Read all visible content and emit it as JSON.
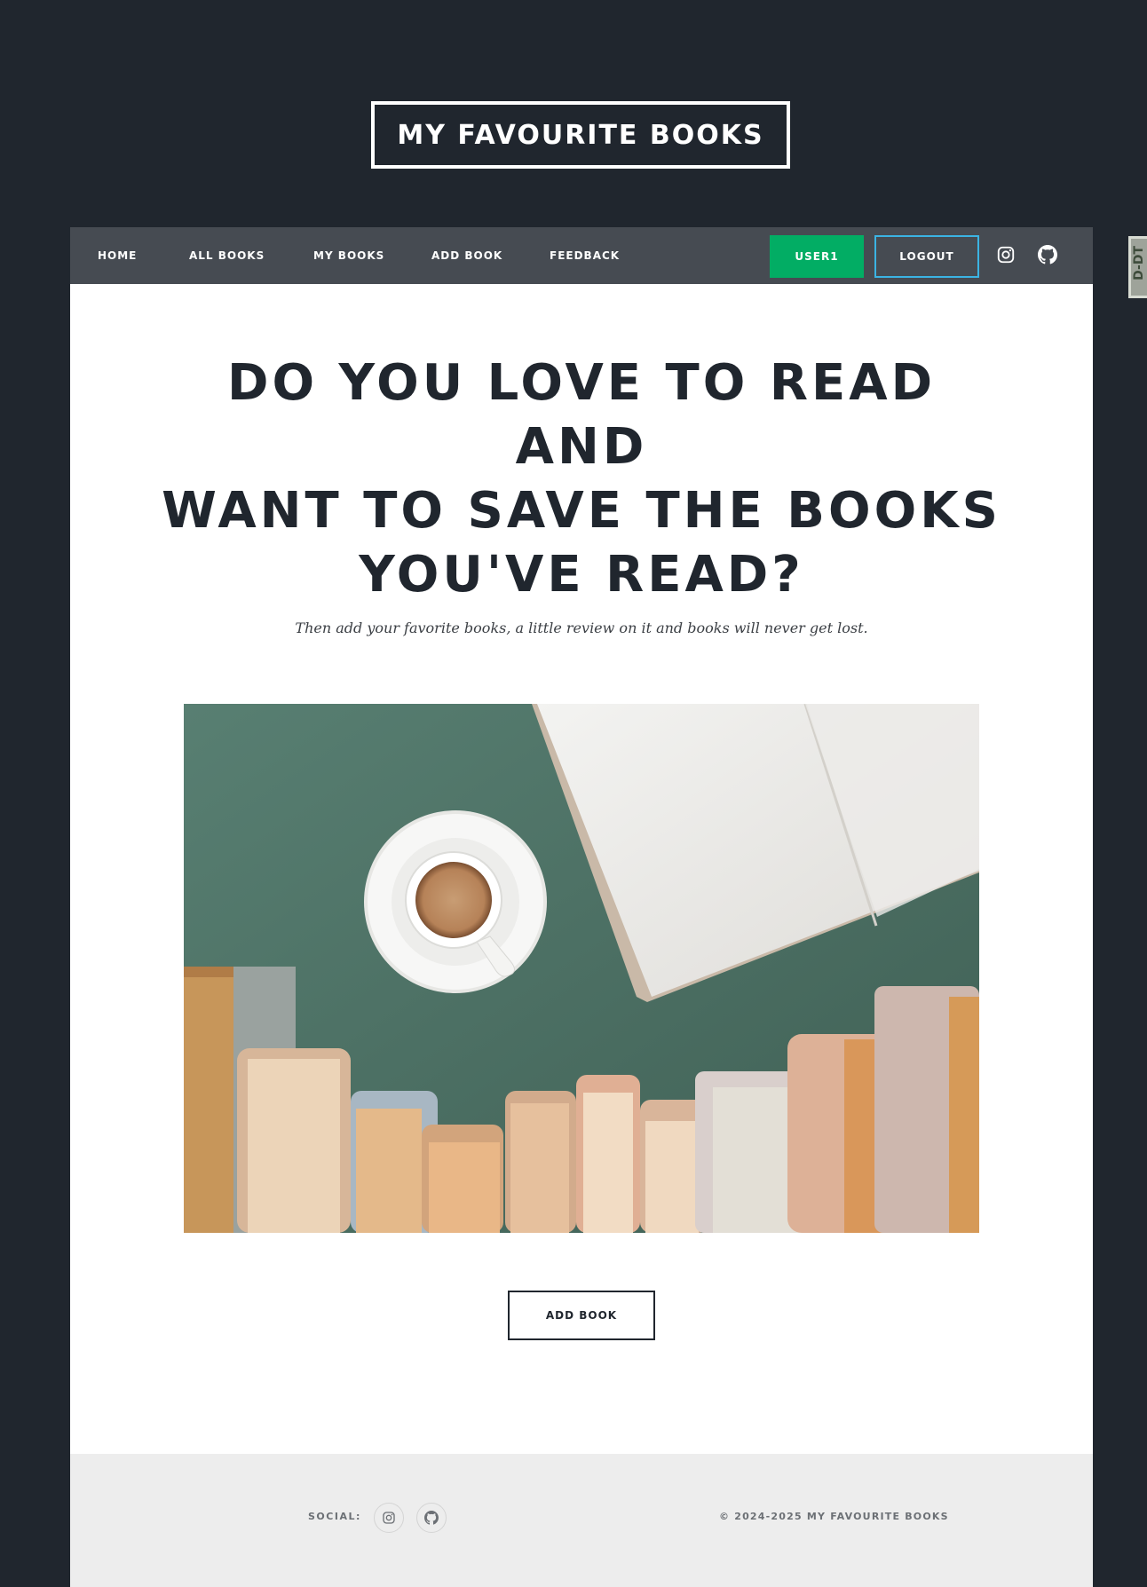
{
  "site": {
    "title": "MY FAVOURITE BOOKS"
  },
  "nav": {
    "links": [
      "HOME",
      "ALL BOOKS",
      "MY BOOKS",
      "ADD BOOK",
      "FEEDBACK"
    ],
    "user_label": "USER1",
    "logout_label": "LOGOUT",
    "icons": [
      "instagram-icon",
      "github-icon"
    ]
  },
  "hero": {
    "headline_lines": [
      "DO YOU LOVE TO READ AND",
      "WANT TO SAVE THE BOOKS",
      "YOU'VE READ?"
    ],
    "subline": "Then add your favorite books, a little review on it and books will never get lost.",
    "button_label": "ADD BOOK"
  },
  "footer": {
    "social_label": "SOCIAL:",
    "copyright": "© 2024-2025 MY FAVOURITE BOOKS"
  },
  "side_tab": {
    "label": "D-DT"
  },
  "colors": {
    "page_bg": "#20262e",
    "nav_bg": "#464b52",
    "user_button": "#02ad64",
    "logout_border": "#3bb4e4",
    "footer_bg": "#ededed",
    "image_green": "#4b6b5f"
  }
}
